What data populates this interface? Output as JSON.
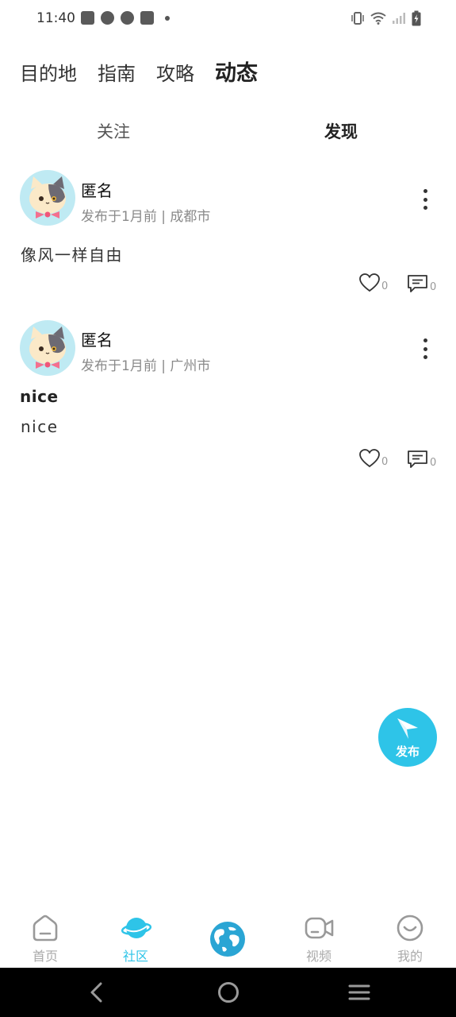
{
  "status_bar": {
    "time": "11:40",
    "left_icons": [
      "shopping-bag-icon",
      "gauge-icon",
      "gauge-icon",
      "shopping-bag-icon",
      "dot-icon"
    ],
    "right_icons": [
      "vibrate-icon",
      "wifi-icon",
      "signal-icon",
      "battery-charging-icon"
    ]
  },
  "top_nav": {
    "tabs": [
      {
        "label": "目的地"
      },
      {
        "label": "指南"
      },
      {
        "label": "攻略"
      },
      {
        "label": "动态",
        "active": true
      }
    ]
  },
  "sub_tabs": {
    "follow": "关注",
    "discover": "发现",
    "active": "discover"
  },
  "posts": [
    {
      "author": "匿名",
      "meta": "发布于1月前 | 成都市",
      "title": "",
      "content": "像风一样自由",
      "likes": "0",
      "comments": "0"
    },
    {
      "author": "匿名",
      "meta": "发布于1月前 | 广州市",
      "title": "nice",
      "content": "nice",
      "likes": "0",
      "comments": "0"
    }
  ],
  "fab": {
    "label": "发布",
    "color": "#2ec4e8"
  },
  "tab_bar": {
    "items": [
      {
        "label": "首页",
        "icon": "home-icon"
      },
      {
        "label": "社区",
        "icon": "planet-icon",
        "active": true
      },
      {
        "label": "",
        "icon": "globe-icon"
      },
      {
        "label": "视频",
        "icon": "video-camera-icon"
      },
      {
        "label": "我的",
        "icon": "smile-icon"
      }
    ],
    "active_color": "#2ec4e8",
    "inactive_color": "#aaaaaa"
  },
  "system_nav": {
    "buttons": [
      "back-icon",
      "home-circle-icon",
      "menu-icon"
    ]
  }
}
